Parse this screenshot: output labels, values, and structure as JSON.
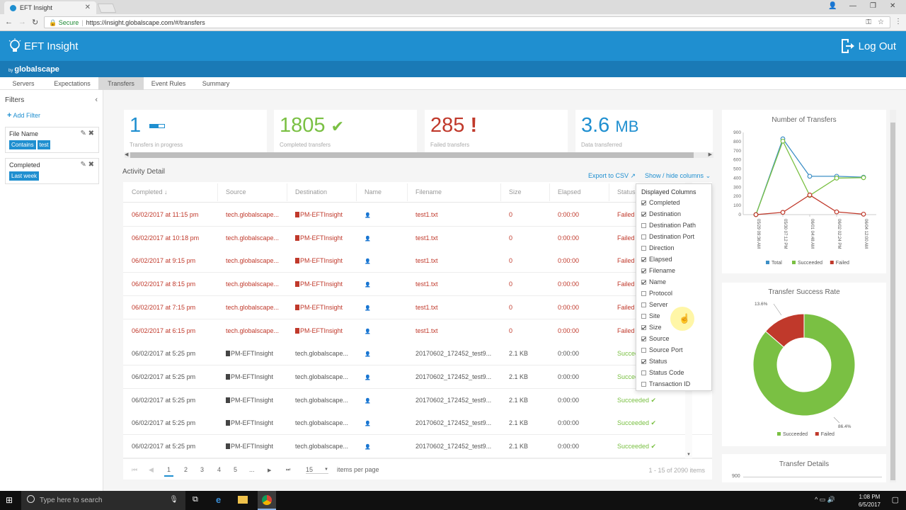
{
  "browser": {
    "tab_title": "EFT Insight",
    "secure_label": "Secure",
    "url": "https://insight.globalscape.com/#/transfers"
  },
  "app": {
    "title": "EFT Insight",
    "by": "by",
    "brand": "globalscape",
    "logout_label": "Log Out"
  },
  "nav_tabs": [
    "Servers",
    "Expectations",
    "Transfers",
    "Event Rules",
    "Summary"
  ],
  "filters": {
    "title": "Filters",
    "add_label": "Add Filter",
    "cards": [
      {
        "label": "File Name",
        "chips": [
          "Contains",
          "test"
        ]
      },
      {
        "label": "Completed",
        "chips": [
          "Last week"
        ]
      }
    ]
  },
  "stats": [
    {
      "value": "1",
      "label": "Transfers in progress",
      "color": "#1f8fd0"
    },
    {
      "value": "1805",
      "label": "Completed transfers",
      "color": "#7ac043"
    },
    {
      "value": "285",
      "label": "Failed transfers",
      "color": "#c0392b"
    },
    {
      "value": "3.6",
      "unit": "MB",
      "label": "Data transferred",
      "color": "#1f8fd0"
    }
  ],
  "activity": {
    "title": "Activity Detail",
    "export_label": "Export to CSV",
    "showhide_label": "Show / hide columns",
    "columns": [
      "Completed",
      "Source",
      "Destination",
      "Name",
      "Filename",
      "Size",
      "Elapsed",
      "Status"
    ],
    "rows": [
      {
        "completed": "06/02/2017 at 11:15 pm",
        "source": "tech.globalscape...",
        "destination": "PM-EFTInsight",
        "filename": "test1.txt",
        "size": "0",
        "elapsed": "0:00:00",
        "status": "Failed"
      },
      {
        "completed": "06/02/2017 at 10:18 pm",
        "source": "tech.globalscape...",
        "destination": "PM-EFTInsight",
        "filename": "test1.txt",
        "size": "0",
        "elapsed": "0:00:00",
        "status": "Failed"
      },
      {
        "completed": "06/02/2017 at 9:15 pm",
        "source": "tech.globalscape...",
        "destination": "PM-EFTInsight",
        "filename": "test1.txt",
        "size": "0",
        "elapsed": "0:00:00",
        "status": "Failed"
      },
      {
        "completed": "06/02/2017 at 8:15 pm",
        "source": "tech.globalscape...",
        "destination": "PM-EFTInsight",
        "filename": "test1.txt",
        "size": "0",
        "elapsed": "0:00:00",
        "status": "Failed"
      },
      {
        "completed": "06/02/2017 at 7:15 pm",
        "source": "tech.globalscape...",
        "destination": "PM-EFTInsight",
        "filename": "test1.txt",
        "size": "0",
        "elapsed": "0:00:00",
        "status": "Failed"
      },
      {
        "completed": "06/02/2017 at 6:15 pm",
        "source": "tech.globalscape...",
        "destination": "PM-EFTInsight",
        "filename": "test1.txt",
        "size": "0",
        "elapsed": "0:00:00",
        "status": "Failed"
      },
      {
        "completed": "06/02/2017 at 5:25 pm",
        "source": "PM-EFTInsight",
        "destination": "tech.globalscape...",
        "filename": "20170602_172452_test9...",
        "size": "2.1 KB",
        "elapsed": "0:00:00",
        "status": "Succeeded"
      },
      {
        "completed": "06/02/2017 at 5:25 pm",
        "source": "PM-EFTInsight",
        "destination": "tech.globalscape...",
        "filename": "20170602_172452_test9...",
        "size": "2.1 KB",
        "elapsed": "0:00:00",
        "status": "Succeeded"
      },
      {
        "completed": "06/02/2017 at 5:25 pm",
        "source": "PM-EFTInsight",
        "destination": "tech.globalscape...",
        "filename": "20170602_172452_test9...",
        "size": "2.1 KB",
        "elapsed": "0:00:00",
        "status": "Succeeded"
      },
      {
        "completed": "06/02/2017 at 5:25 pm",
        "source": "PM-EFTInsight",
        "destination": "tech.globalscape...",
        "filename": "20170602_172452_test9...",
        "size": "2.1 KB",
        "elapsed": "0:00:00",
        "status": "Succeeded"
      },
      {
        "completed": "06/02/2017 at 5:25 pm",
        "source": "PM-EFTInsight",
        "destination": "tech.globalscape...",
        "filename": "20170602_172452_test9...",
        "size": "2.1 KB",
        "elapsed": "0:00:00",
        "status": "Succeeded"
      }
    ]
  },
  "pager": {
    "pages": [
      "1",
      "2",
      "3",
      "4",
      "5",
      "..."
    ],
    "current": "1",
    "per_page": "15",
    "per_page_label": "items per page",
    "count": "1 - 15 of 2090 items"
  },
  "column_menu": {
    "title": "Displayed Columns",
    "items": [
      {
        "label": "Completed",
        "checked": true
      },
      {
        "label": "Destination",
        "checked": true
      },
      {
        "label": "Destination Path",
        "checked": false
      },
      {
        "label": "Destination Port",
        "checked": false
      },
      {
        "label": "Direction",
        "checked": false
      },
      {
        "label": "Elapsed",
        "checked": true
      },
      {
        "label": "Filename",
        "checked": true
      },
      {
        "label": "Name",
        "checked": true
      },
      {
        "label": "Protocol",
        "checked": false
      },
      {
        "label": "Server",
        "checked": false
      },
      {
        "label": "Site",
        "checked": false
      },
      {
        "label": "Size",
        "checked": true
      },
      {
        "label": "Source",
        "checked": true
      },
      {
        "label": "Source Port",
        "checked": false
      },
      {
        "label": "Status",
        "checked": true
      },
      {
        "label": "Status Code",
        "checked": false
      },
      {
        "label": "Transaction ID",
        "checked": false
      }
    ]
  },
  "chart_data": [
    {
      "type": "line",
      "title": "Number of Transfers",
      "x": [
        "05/29 09:36 AM",
        "05/30 07:12 PM",
        "06/01 04:48 AM",
        "06/02 02:24 PM",
        "06/04 12:00 AM"
      ],
      "ylim": [
        0,
        900
      ],
      "yticks": [
        0,
        100,
        200,
        300,
        400,
        500,
        600,
        700,
        800,
        900
      ],
      "series": [
        {
          "name": "Total",
          "color": "#3d8fc6",
          "points": [
            [
              0,
              0
            ],
            [
              1,
              830
            ],
            [
              2,
              420
            ],
            [
              3,
              420
            ],
            [
              4,
              410
            ]
          ]
        },
        {
          "name": "Succeeded",
          "color": "#7ac043",
          "points": [
            [
              0,
              0
            ],
            [
              1,
              805
            ],
            [
              2,
              210
            ],
            [
              3,
              400
            ],
            [
              4,
              405
            ]
          ]
        },
        {
          "name": "Failed",
          "color": "#c0392b",
          "points": [
            [
              0,
              0
            ],
            [
              1,
              25
            ],
            [
              2,
              215
            ],
            [
              3,
              30
            ],
            [
              4,
              5
            ]
          ]
        }
      ],
      "legend_position": "bottom",
      "grid": false
    },
    {
      "type": "pie",
      "title": "Transfer Success Rate",
      "categories": [
        "Succeeded",
        "Failed"
      ],
      "values": [
        86.4,
        13.6
      ],
      "labels": [
        "86.4%",
        "13.6%"
      ],
      "colors": [
        "#7ac043",
        "#c0392b"
      ],
      "legend_position": "bottom"
    }
  ],
  "details_panel": {
    "title": "Transfer Details",
    "first_tick": "900"
  },
  "taskbar": {
    "search_placeholder": "Type here to search",
    "time": "1:08 PM",
    "date": "6/5/2017"
  }
}
